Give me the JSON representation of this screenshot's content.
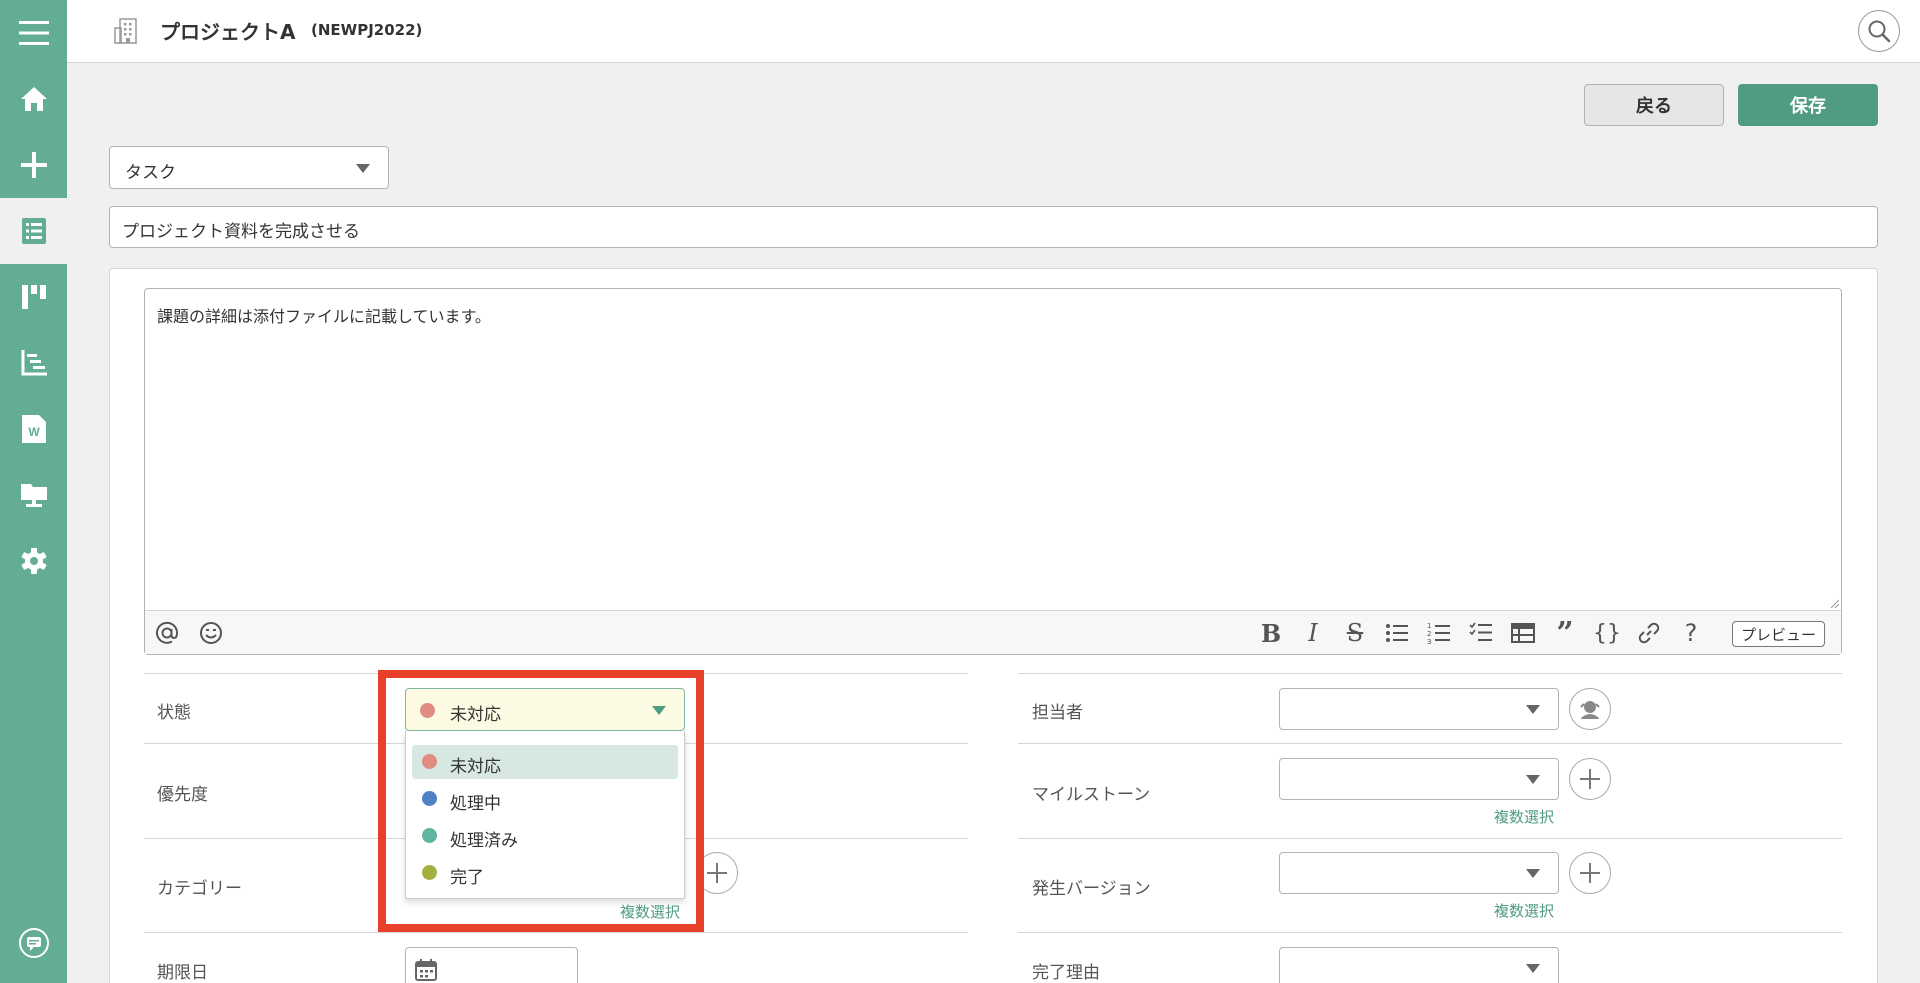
{
  "header": {
    "project_name": "プロジェクトA",
    "project_key": "(NEWPJ2022)"
  },
  "sidebar": {
    "items": [
      {
        "icon": "menu-icon"
      },
      {
        "icon": "home-icon"
      },
      {
        "icon": "add-icon"
      },
      {
        "icon": "issue-list-icon",
        "active": true
      },
      {
        "icon": "board-icon"
      },
      {
        "icon": "gantt-icon"
      },
      {
        "icon": "wiki-icon"
      },
      {
        "icon": "files-icon"
      },
      {
        "icon": "settings-icon"
      },
      {
        "icon": "help-chat-icon"
      }
    ]
  },
  "toolbar": {
    "back_label": "戻る",
    "save_label": "保存"
  },
  "issue": {
    "type": "タスク",
    "title": "プロジェクト資料を完成させる",
    "description": "課題の詳細は添付ファイルに記載しています。"
  },
  "editor": {
    "preview_label": "プレビュー",
    "tools": [
      "mention-icon",
      "emoji-icon",
      "bold-icon",
      "italic-icon",
      "strikethrough-icon",
      "bullet-list-icon",
      "numbered-list-icon",
      "checklist-icon",
      "table-icon",
      "quote-icon",
      "code-icon",
      "link-icon",
      "help-icon"
    ]
  },
  "fields": {
    "status_label": "状態",
    "priority_label": "優先度",
    "category_label": "カテゴリー",
    "due_date_label": "期限日",
    "assignee_label": "担当者",
    "milestone_label": "マイルストーン",
    "version_label": "発生バージョン",
    "resolution_label": "完了理由",
    "multi_select_label": "複数選択"
  },
  "status_dropdown": {
    "selected": "未対応",
    "selected_color": "#e08c80",
    "options": [
      {
        "label": "未対応",
        "color": "#e08c80"
      },
      {
        "label": "処理中",
        "color": "#4e80c4"
      },
      {
        "label": "処理済み",
        "color": "#5eb5a0"
      },
      {
        "label": "完了",
        "color": "#a3b040"
      }
    ]
  },
  "colors": {
    "brand": "#63ad92",
    "save_button": "#4f9c80",
    "highlight": "#e8402a"
  }
}
